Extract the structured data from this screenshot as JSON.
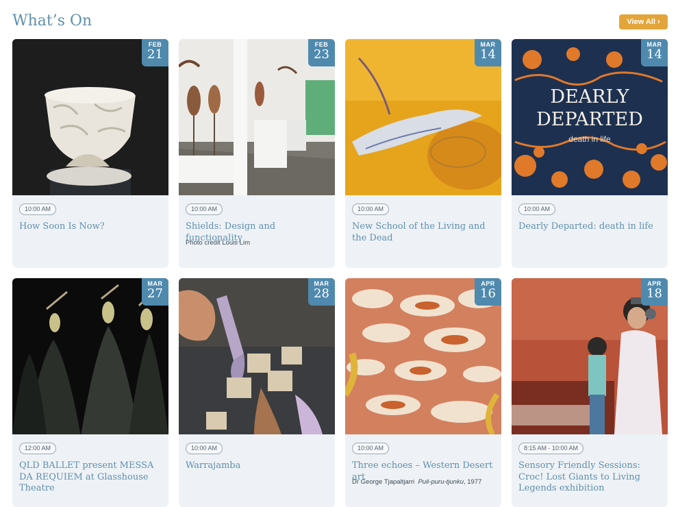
{
  "header": {
    "title": "What’s On",
    "view_all_label": "View All ›"
  },
  "events": [
    {
      "month": "FEB",
      "day": "21",
      "time": "10:00 AM",
      "title": "How Soon Is Now?",
      "credit": "",
      "image": "white-ceramic-vessel"
    },
    {
      "month": "FEB",
      "day": "23",
      "time": "10:00 AM",
      "title": "Shields: Design and functionality",
      "credit": "Photo credit Louis Lim",
      "image": "gallery-shields"
    },
    {
      "month": "MAR",
      "day": "14",
      "time": "10:00 AM",
      "title": "New School of the Living and the Dead",
      "credit": "",
      "image": "yellow-painting"
    },
    {
      "month": "MAR",
      "day": "14",
      "time": "10:00 AM",
      "title": "Dearly Departed: death in life",
      "credit": "",
      "image": "dearly-departed-poster",
      "poster_line1": "DEARLY",
      "poster_line2": "DEPARTED",
      "poster_sub": "death in life"
    },
    {
      "month": "MAR",
      "day": "27",
      "time": "12:00 AM",
      "title": "QLD BALLET present MESSA DA REQUIEM at Glasshouse Theatre",
      "credit": "",
      "image": "ballet-dancers"
    },
    {
      "month": "MAR",
      "day": "28",
      "time": "10:00 AM",
      "title": "Warrajamba",
      "credit": "",
      "image": "printmaking-hands"
    },
    {
      "month": "APR",
      "day": "16",
      "time": "10:00 AM",
      "title": "Three echoes – Western Desert art",
      "credit": "Dr George Tjapaltjarri",
      "credit_italic": "Puli-puru-tjunku",
      "credit_year": ", 1977",
      "image": "desert-dot-painting"
    },
    {
      "month": "APR",
      "day": "18",
      "time": "8:15 AM - 10:00 AM",
      "title": "Sensory Friendly Sessions: Croc! Lost Giants to Living Legends exhibition",
      "credit": "",
      "image": "children-headphones"
    }
  ],
  "colors": {
    "accent": "#e3a53a",
    "date_badge": "#4f8aae",
    "title_text": "#5f8fad",
    "card_bg": "#eef2f6"
  }
}
